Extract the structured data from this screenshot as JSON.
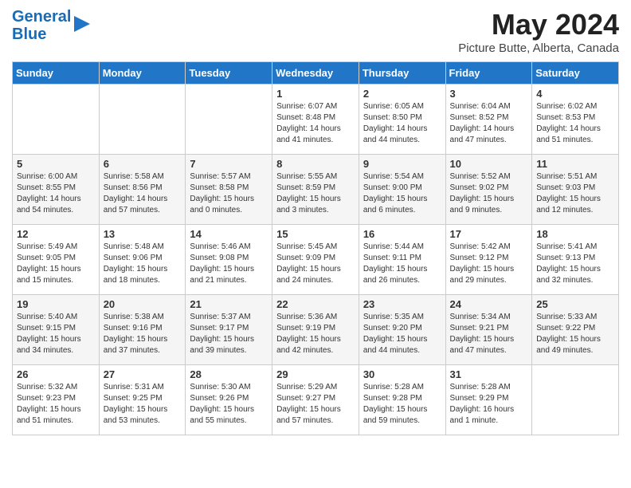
{
  "header": {
    "logo_line1": "General",
    "logo_line2": "Blue",
    "month": "May 2024",
    "location": "Picture Butte, Alberta, Canada"
  },
  "days_of_week": [
    "Sunday",
    "Monday",
    "Tuesday",
    "Wednesday",
    "Thursday",
    "Friday",
    "Saturday"
  ],
  "weeks": [
    [
      {
        "day": "",
        "text": ""
      },
      {
        "day": "",
        "text": ""
      },
      {
        "day": "",
        "text": ""
      },
      {
        "day": "1",
        "text": "Sunrise: 6:07 AM\nSunset: 8:48 PM\nDaylight: 14 hours\nand 41 minutes."
      },
      {
        "day": "2",
        "text": "Sunrise: 6:05 AM\nSunset: 8:50 PM\nDaylight: 14 hours\nand 44 minutes."
      },
      {
        "day": "3",
        "text": "Sunrise: 6:04 AM\nSunset: 8:52 PM\nDaylight: 14 hours\nand 47 minutes."
      },
      {
        "day": "4",
        "text": "Sunrise: 6:02 AM\nSunset: 8:53 PM\nDaylight: 14 hours\nand 51 minutes."
      }
    ],
    [
      {
        "day": "5",
        "text": "Sunrise: 6:00 AM\nSunset: 8:55 PM\nDaylight: 14 hours\nand 54 minutes."
      },
      {
        "day": "6",
        "text": "Sunrise: 5:58 AM\nSunset: 8:56 PM\nDaylight: 14 hours\nand 57 minutes."
      },
      {
        "day": "7",
        "text": "Sunrise: 5:57 AM\nSunset: 8:58 PM\nDaylight: 15 hours\nand 0 minutes."
      },
      {
        "day": "8",
        "text": "Sunrise: 5:55 AM\nSunset: 8:59 PM\nDaylight: 15 hours\nand 3 minutes."
      },
      {
        "day": "9",
        "text": "Sunrise: 5:54 AM\nSunset: 9:00 PM\nDaylight: 15 hours\nand 6 minutes."
      },
      {
        "day": "10",
        "text": "Sunrise: 5:52 AM\nSunset: 9:02 PM\nDaylight: 15 hours\nand 9 minutes."
      },
      {
        "day": "11",
        "text": "Sunrise: 5:51 AM\nSunset: 9:03 PM\nDaylight: 15 hours\nand 12 minutes."
      }
    ],
    [
      {
        "day": "12",
        "text": "Sunrise: 5:49 AM\nSunset: 9:05 PM\nDaylight: 15 hours\nand 15 minutes."
      },
      {
        "day": "13",
        "text": "Sunrise: 5:48 AM\nSunset: 9:06 PM\nDaylight: 15 hours\nand 18 minutes."
      },
      {
        "day": "14",
        "text": "Sunrise: 5:46 AM\nSunset: 9:08 PM\nDaylight: 15 hours\nand 21 minutes."
      },
      {
        "day": "15",
        "text": "Sunrise: 5:45 AM\nSunset: 9:09 PM\nDaylight: 15 hours\nand 24 minutes."
      },
      {
        "day": "16",
        "text": "Sunrise: 5:44 AM\nSunset: 9:11 PM\nDaylight: 15 hours\nand 26 minutes."
      },
      {
        "day": "17",
        "text": "Sunrise: 5:42 AM\nSunset: 9:12 PM\nDaylight: 15 hours\nand 29 minutes."
      },
      {
        "day": "18",
        "text": "Sunrise: 5:41 AM\nSunset: 9:13 PM\nDaylight: 15 hours\nand 32 minutes."
      }
    ],
    [
      {
        "day": "19",
        "text": "Sunrise: 5:40 AM\nSunset: 9:15 PM\nDaylight: 15 hours\nand 34 minutes."
      },
      {
        "day": "20",
        "text": "Sunrise: 5:38 AM\nSunset: 9:16 PM\nDaylight: 15 hours\nand 37 minutes."
      },
      {
        "day": "21",
        "text": "Sunrise: 5:37 AM\nSunset: 9:17 PM\nDaylight: 15 hours\nand 39 minutes."
      },
      {
        "day": "22",
        "text": "Sunrise: 5:36 AM\nSunset: 9:19 PM\nDaylight: 15 hours\nand 42 minutes."
      },
      {
        "day": "23",
        "text": "Sunrise: 5:35 AM\nSunset: 9:20 PM\nDaylight: 15 hours\nand 44 minutes."
      },
      {
        "day": "24",
        "text": "Sunrise: 5:34 AM\nSunset: 9:21 PM\nDaylight: 15 hours\nand 47 minutes."
      },
      {
        "day": "25",
        "text": "Sunrise: 5:33 AM\nSunset: 9:22 PM\nDaylight: 15 hours\nand 49 minutes."
      }
    ],
    [
      {
        "day": "26",
        "text": "Sunrise: 5:32 AM\nSunset: 9:23 PM\nDaylight: 15 hours\nand 51 minutes."
      },
      {
        "day": "27",
        "text": "Sunrise: 5:31 AM\nSunset: 9:25 PM\nDaylight: 15 hours\nand 53 minutes."
      },
      {
        "day": "28",
        "text": "Sunrise: 5:30 AM\nSunset: 9:26 PM\nDaylight: 15 hours\nand 55 minutes."
      },
      {
        "day": "29",
        "text": "Sunrise: 5:29 AM\nSunset: 9:27 PM\nDaylight: 15 hours\nand 57 minutes."
      },
      {
        "day": "30",
        "text": "Sunrise: 5:28 AM\nSunset: 9:28 PM\nDaylight: 15 hours\nand 59 minutes."
      },
      {
        "day": "31",
        "text": "Sunrise: 5:28 AM\nSunset: 9:29 PM\nDaylight: 16 hours\nand 1 minute."
      },
      {
        "day": "",
        "text": ""
      }
    ]
  ]
}
